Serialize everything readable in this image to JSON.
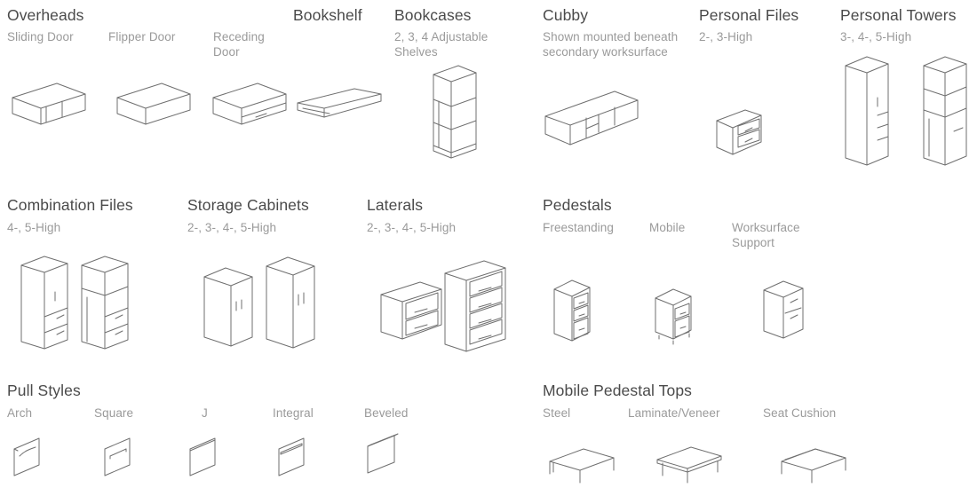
{
  "groups": {
    "overheads": {
      "title": "Overheads",
      "options": [
        "Sliding Door",
        "Flipper Door",
        "Receding Door"
      ]
    },
    "bookshelf": {
      "title": "Bookshelf"
    },
    "bookcases": {
      "title": "Bookcases",
      "note": "2, 3, 4 Adjustable Shelves"
    },
    "cubby": {
      "title": "Cubby",
      "note": "Shown mounted beneath secondary worksurface"
    },
    "personal_files": {
      "title": "Personal Files",
      "note": "2-, 3-High"
    },
    "personal_towers": {
      "title": "Personal Towers",
      "note": "3-, 4-, 5-High"
    },
    "combination_files": {
      "title": "Combination Files",
      "note": "4-, 5-High"
    },
    "storage_cabinets": {
      "title": "Storage Cabinets",
      "note": "2-, 3-, 4-, 5-High"
    },
    "laterals": {
      "title": "Laterals",
      "note": "2-, 3-, 4-, 5-High"
    },
    "pedestals": {
      "title": "Pedestals",
      "options": [
        "Freestanding",
        "Mobile",
        "Worksurface Support"
      ]
    },
    "pull_styles": {
      "title": "Pull Styles",
      "options": [
        "Arch",
        "Square",
        "J",
        "Integral",
        "Beveled"
      ]
    },
    "mobile_pedestal_tops": {
      "title": "Mobile Pedestal Tops",
      "options": [
        "Steel",
        "Laminate/Veneer",
        "Seat Cushion"
      ]
    }
  },
  "icons": [
    "overhead-sliding-door-icon",
    "overhead-flipper-door-icon",
    "overhead-receding-door-icon",
    "bookshelf-icon",
    "bookcase-icon",
    "cubby-icon",
    "personal-file-icon",
    "personal-tower-icon",
    "combination-file-icon",
    "storage-cabinet-icon",
    "lateral-file-icon",
    "pedestal-icon",
    "pull-style-icon",
    "pedestal-top-icon"
  ]
}
